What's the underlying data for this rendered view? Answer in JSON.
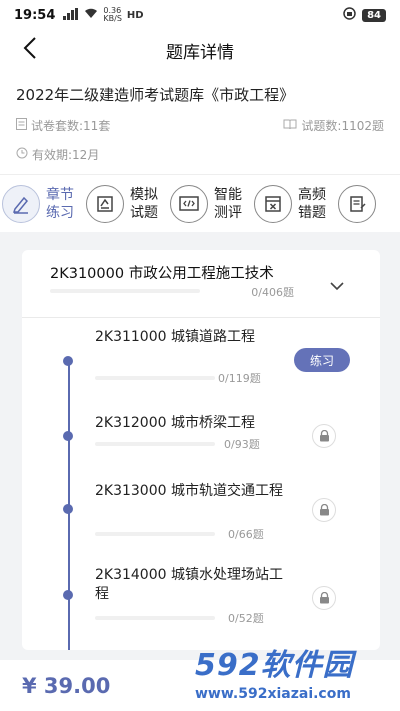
{
  "status_bar": {
    "time": "19:54",
    "net_speed_top": "0.36",
    "net_speed_bottom": "KB/S",
    "network": "HD",
    "battery": "84"
  },
  "header": {
    "title": "题库详情",
    "back_icon": "back-arrow-icon"
  },
  "bank": {
    "title": "2022年二级建造师考试题库《市政工程》",
    "paper_count": "试卷套数:11套",
    "question_count": "试题数:1102题",
    "validity": "有效期:12月"
  },
  "tabs": [
    {
      "label": "章节练习",
      "icon": "pen-icon",
      "active": true
    },
    {
      "label": "模拟试题",
      "icon": "exam-paper-icon",
      "active": false
    },
    {
      "label": "智能测评",
      "icon": "code-screen-icon",
      "active": false
    },
    {
      "label": "高频错题",
      "icon": "wrong-question-icon",
      "active": false
    },
    {
      "label": "",
      "icon": "notes-icon",
      "active": false
    }
  ],
  "chapter": {
    "title": "2K310000 市政公用工程施工技术",
    "count": "0/406题"
  },
  "sections": [
    {
      "title": "2K311000 城镇道路工程",
      "count": "0/119题",
      "action": "练习",
      "locked": false
    },
    {
      "title": "2K312000 城市桥梁工程",
      "count": "0/93题",
      "locked": true
    },
    {
      "title": "2K313000 城市轨道交通工程",
      "count": "0/66题",
      "locked": true
    },
    {
      "title": "2K314000 城镇水处理场站工程",
      "count": "0/52题",
      "locked": true
    }
  ],
  "footer": {
    "price": "¥ 39.00"
  },
  "watermark": {
    "logo": "592软件园",
    "url": "www.592xiazai.com"
  },
  "colors": {
    "accent": "#5a6ab0",
    "button": "#6472b8",
    "watermark": "#3a6ec8"
  }
}
